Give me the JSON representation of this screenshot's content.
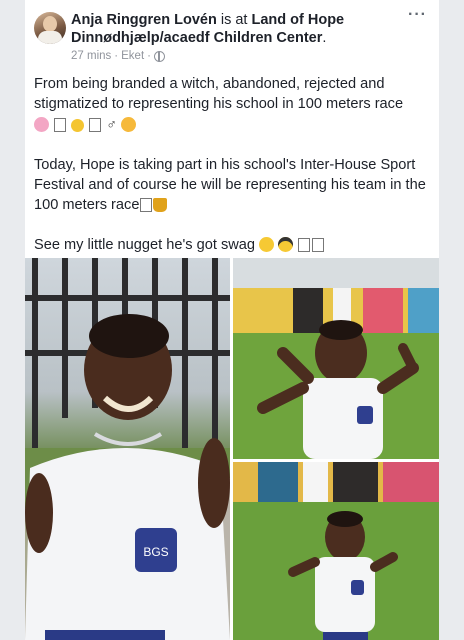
{
  "post": {
    "author": "Anja Ringgren Lovén",
    "is_at": " is at ",
    "location": "Land of Hope Dinnødhjælp/acaedf Children Center",
    "location_end": ".",
    "time": "27 mins",
    "sep": "·",
    "edited": "Eket",
    "more_label": "···",
    "paragraph1": "From being branded a witch, abandoned, rejected and stigmatized to representing his school in 100 meters race",
    "paragraph2": "Today, Hope is taking part in his school's Inter-House Sport Festival and of course he will be representing his team in the 100 meters race",
    "paragraph3": "See my little nugget he's got swag"
  },
  "icons": [
    "globe-icon",
    "more-options-icon",
    "avatar"
  ],
  "colors": {
    "text": "#1d2129",
    "meta": "#90949c",
    "background": "#e9ebee",
    "card": "#ffffff"
  },
  "photos": [
    "boy-thumbs-up-photo",
    "boy-pose-field-photo",
    "boy-pose-field-photo-2"
  ]
}
